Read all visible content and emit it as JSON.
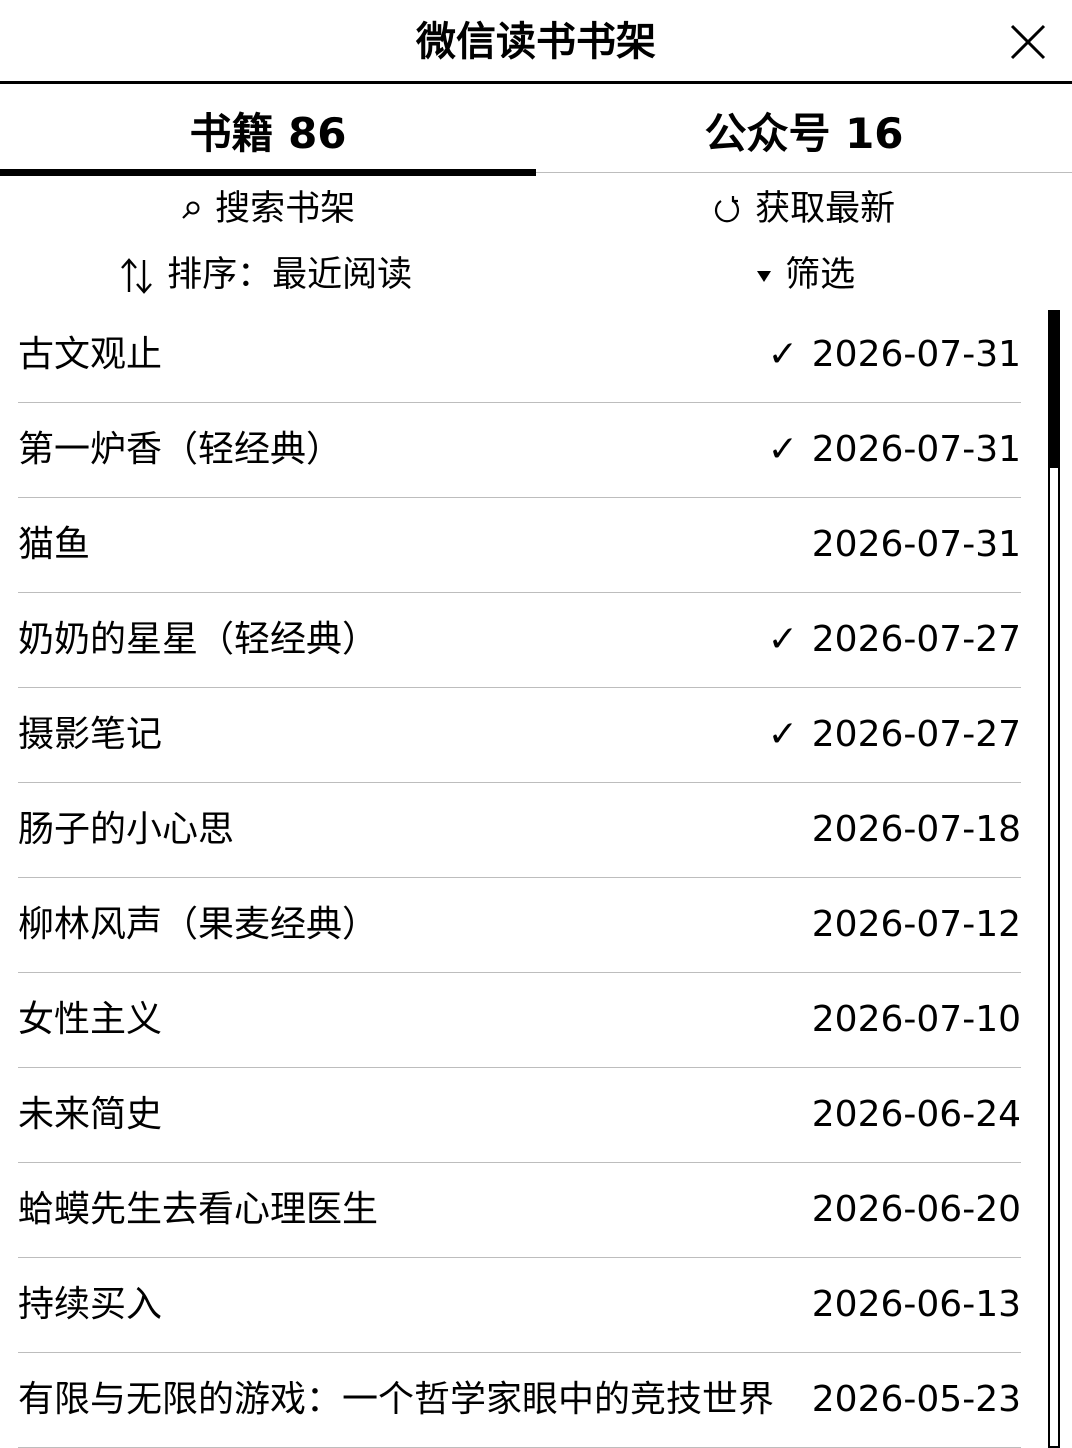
{
  "header": {
    "title": "微信读书书架"
  },
  "tabs": [
    {
      "label": "书籍 86",
      "active": true
    },
    {
      "label": "公众号 16",
      "active": false
    }
  ],
  "toolbar": {
    "search_label": "搜索书架",
    "refresh_label": "获取最新",
    "sort_label": "排序：最近阅读",
    "filter_label": "筛选"
  },
  "books": [
    {
      "title": "古文观止",
      "checked": true,
      "check": "✓",
      "date": "2026-07-31"
    },
    {
      "title": "第一炉香（轻经典）",
      "checked": true,
      "check": "✓",
      "date": "2026-07-31"
    },
    {
      "title": "猫鱼",
      "checked": false,
      "check": "",
      "date": "2026-07-31"
    },
    {
      "title": "奶奶的星星（轻经典）",
      "checked": true,
      "check": "✓",
      "date": "2026-07-27"
    },
    {
      "title": "摄影笔记",
      "checked": true,
      "check": "✓",
      "date": "2026-07-27"
    },
    {
      "title": "肠子的小心思",
      "checked": false,
      "check": "",
      "date": "2026-07-18"
    },
    {
      "title": "柳林风声（果麦经典）",
      "checked": false,
      "check": "",
      "date": "2026-07-12"
    },
    {
      "title": "女性主义",
      "checked": false,
      "check": "",
      "date": "2026-07-10"
    },
    {
      "title": "未来简史",
      "checked": false,
      "check": "",
      "date": "2026-06-24"
    },
    {
      "title": "蛤蟆先生去看心理医生",
      "checked": false,
      "check": "",
      "date": "2026-06-20"
    },
    {
      "title": "持续买入",
      "checked": false,
      "check": "",
      "date": "2026-06-13"
    },
    {
      "title": "有限与无限的游戏：一个哲学家眼中的竞技世界",
      "checked": false,
      "check": "",
      "date": "2026-05-23"
    }
  ],
  "icons": {
    "close": "close-icon",
    "search": "search-icon",
    "refresh": "refresh-icon",
    "sort": "sort-icon",
    "filter": "filter-triangle-icon",
    "check": "check-icon"
  },
  "colors": {
    "foreground": "#000000",
    "background": "#ffffff",
    "divider": "#bdbdbd"
  },
  "scroll": {
    "position": 0.0,
    "visible_fraction": 0.14
  }
}
